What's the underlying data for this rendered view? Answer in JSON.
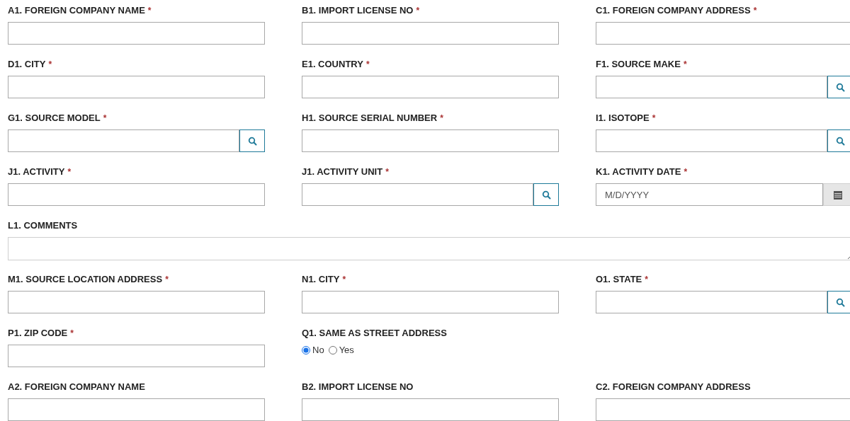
{
  "rows": [
    {
      "fields": [
        {
          "kind": "text",
          "label": "A1. FOREIGN COMPANY NAME",
          "marker": "*"
        },
        {
          "kind": "text",
          "label": "B1. IMPORT LICENSE NO",
          "marker": "*"
        },
        {
          "kind": "text",
          "label": "C1. FOREIGN COMPANY ADDRESS",
          "marker": "*"
        }
      ]
    },
    {
      "fields": [
        {
          "kind": "text",
          "label": "D1. CITY",
          "marker": "*"
        },
        {
          "kind": "text",
          "label": "E1. COUNTRY",
          "marker": "*"
        },
        {
          "kind": "lookup",
          "label": "F1. SOURCE MAKE",
          "marker": "*"
        }
      ]
    },
    {
      "fields": [
        {
          "kind": "lookup",
          "label": "G1. SOURCE MODEL",
          "marker": "*"
        },
        {
          "kind": "text",
          "label": "H1. SOURCE SERIAL NUMBER",
          "marker": "*"
        },
        {
          "kind": "lookup",
          "label": "I1. ISOTOPE",
          "marker": "*"
        }
      ]
    },
    {
      "fields": [
        {
          "kind": "text",
          "label": "J1. ACTIVITY",
          "marker": "*"
        },
        {
          "kind": "lookup",
          "label": "J1. ACTIVITY UNIT",
          "marker": "*"
        },
        {
          "kind": "date",
          "label": "K1. ACTIVITY DATE",
          "marker": "*",
          "placeholder": "M/D/YYYY"
        }
      ]
    },
    {
      "fields": [
        {
          "kind": "textarea",
          "label": "L1. COMMENTS"
        }
      ]
    },
    {
      "fields": [
        {
          "kind": "text",
          "label": "M1. SOURCE LOCATION ADDRESS",
          "marker": "*"
        },
        {
          "kind": "text",
          "label": "N1. CITY",
          "marker": "*"
        },
        {
          "kind": "lookup",
          "label": "O1. STATE",
          "marker": "*"
        }
      ]
    },
    {
      "fields": [
        {
          "kind": "text",
          "label": "P1. ZIP CODE",
          "marker": "*"
        },
        {
          "kind": "radio",
          "label": "Q1. SAME AS STREET ADDRESS",
          "options": [
            {
              "label": "No",
              "selected": true
            },
            {
              "label": "Yes",
              "selected": false
            }
          ]
        }
      ]
    },
    {
      "fields": [
        {
          "kind": "text",
          "label": "A2. FOREIGN COMPANY NAME"
        },
        {
          "kind": "text",
          "label": "B2. IMPORT LICENSE NO"
        },
        {
          "kind": "text",
          "label": "C2. FOREIGN COMPANY ADDRESS"
        }
      ]
    }
  ]
}
